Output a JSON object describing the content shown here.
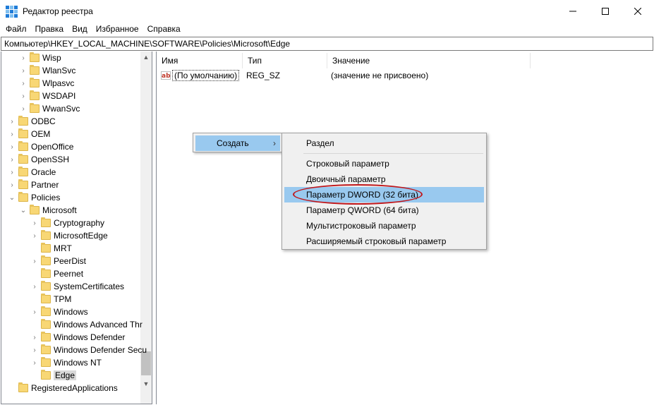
{
  "window": {
    "title": "Редактор реестра",
    "minimize_icon": "minimize-icon",
    "maximize_icon": "maximize-icon",
    "close_icon": "close-icon"
  },
  "menu": [
    "Файл",
    "Правка",
    "Вид",
    "Избранное",
    "Справка"
  ],
  "address": "Компьютер\\HKEY_LOCAL_MACHINE\\SOFTWARE\\Policies\\Microsoft\\Edge",
  "tree": {
    "items": [
      {
        "label": "Wisp",
        "depth": 2,
        "expander": true
      },
      {
        "label": "WlanSvc",
        "depth": 2,
        "expander": true
      },
      {
        "label": "Wlpasvc",
        "depth": 2,
        "expander": true
      },
      {
        "label": "WSDAPI",
        "depth": 2,
        "expander": true
      },
      {
        "label": "WwanSvc",
        "depth": 2,
        "expander": true
      },
      {
        "label": "ODBC",
        "depth": 1,
        "expander": true
      },
      {
        "label": "OEM",
        "depth": 1,
        "expander": true
      },
      {
        "label": "OpenOffice",
        "depth": 1,
        "expander": true
      },
      {
        "label": "OpenSSH",
        "depth": 1,
        "expander": true
      },
      {
        "label": "Oracle",
        "depth": 1,
        "expander": true
      },
      {
        "label": "Partner",
        "depth": 1,
        "expander": true
      },
      {
        "label": "Policies",
        "depth": 1,
        "expander": true,
        "expanded": true
      },
      {
        "label": "Microsoft",
        "depth": 2,
        "expander": true,
        "expanded": true
      },
      {
        "label": "Cryptography",
        "depth": 3,
        "expander": true
      },
      {
        "label": "MicrosoftEdge",
        "depth": 3,
        "expander": true
      },
      {
        "label": "MRT",
        "depth": 3,
        "expander": false
      },
      {
        "label": "PeerDist",
        "depth": 3,
        "expander": true
      },
      {
        "label": "Peernet",
        "depth": 3,
        "expander": false
      },
      {
        "label": "SystemCertificates",
        "depth": 3,
        "expander": true
      },
      {
        "label": "TPM",
        "depth": 3,
        "expander": false
      },
      {
        "label": "Windows",
        "depth": 3,
        "expander": true
      },
      {
        "label": "Windows Advanced Thr",
        "depth": 3,
        "expander": false
      },
      {
        "label": "Windows Defender",
        "depth": 3,
        "expander": true
      },
      {
        "label": "Windows Defender Secu",
        "depth": 3,
        "expander": true
      },
      {
        "label": "Windows NT",
        "depth": 3,
        "expander": true
      },
      {
        "label": "Edge",
        "depth": 3,
        "expander": false,
        "selected": true
      },
      {
        "label": "RegisteredApplications",
        "depth": 1,
        "expander": false
      }
    ]
  },
  "list": {
    "columns": [
      "Имя",
      "Тип",
      "Значение"
    ],
    "rows": [
      {
        "name": "(По умолчанию)",
        "type": "REG_SZ",
        "value": "(значение не присвоено)",
        "icon": "ab"
      }
    ]
  },
  "context_menu": {
    "item": "Создать",
    "arrow": "›"
  },
  "submenu": {
    "items": [
      "Раздел",
      "Строковый параметр",
      "Двоичный параметр",
      "Параметр DWORD (32 бита)",
      "Параметр QWORD (64 бита)",
      "Мультистроковый параметр",
      "Расширяемый строковый параметр"
    ],
    "highlighted_index": 3
  },
  "colors": {
    "highlight": "#99c9ef",
    "annotation": "#c0171b",
    "folder": "#f8d775"
  }
}
